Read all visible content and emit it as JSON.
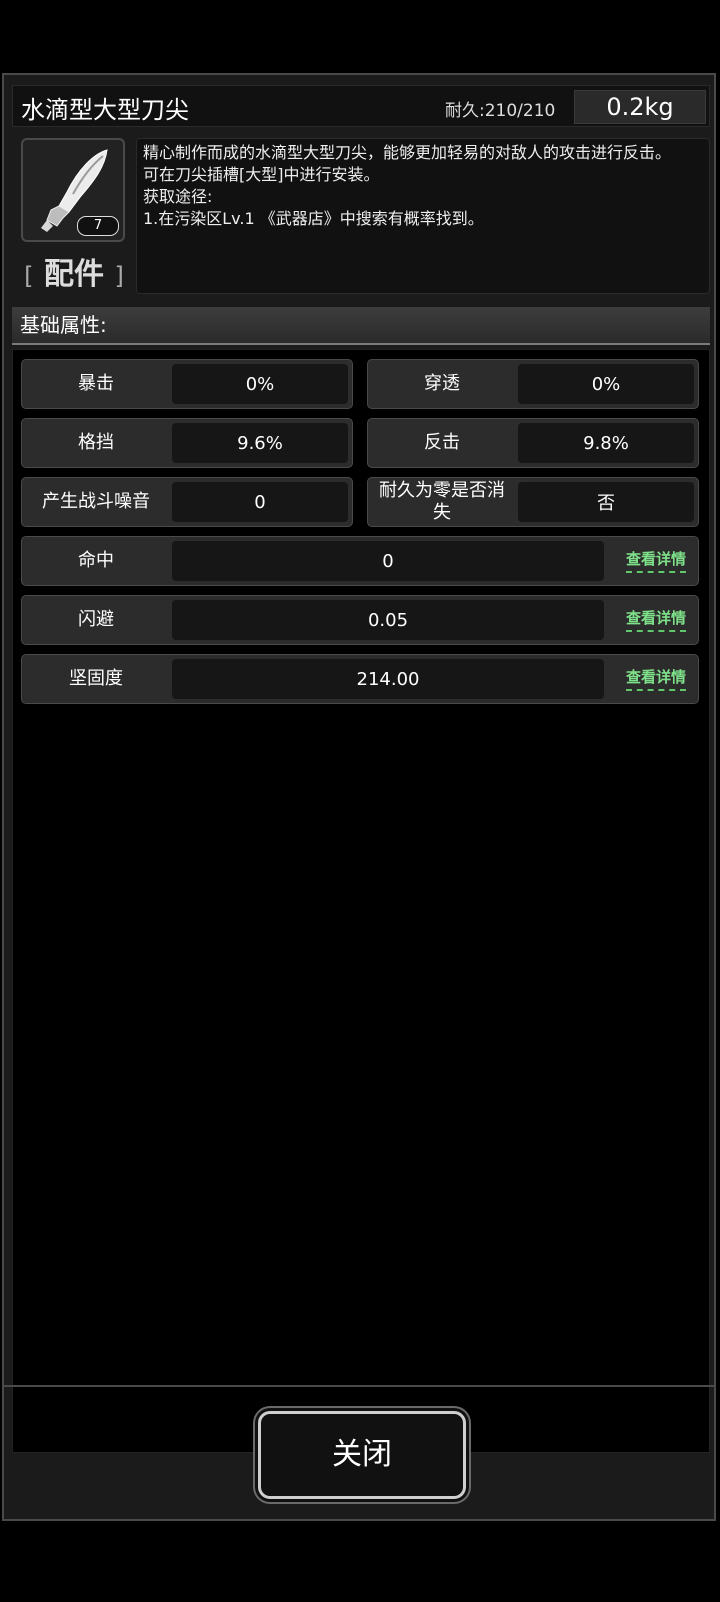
{
  "item": {
    "name": "水滴型大型刀尖",
    "durability": "耐久:210/210",
    "weight": "0.2kg",
    "count": "7",
    "category_open": "[",
    "category": "配件",
    "category_close": "]",
    "icon": "blade-tip-icon"
  },
  "description": {
    "lines": [
      "精心制作而成的水滴型大型刀尖，能够更加轻易的对敌人的攻击进行反击。",
      "可在刀尖插槽[大型]中进行安装。",
      "获取途径:",
      "1.在污染区Lv.1 《武器店》中搜索有概率找到。"
    ]
  },
  "section": {
    "title": "基础属性:"
  },
  "stats": {
    "crit": {
      "label": "暴击",
      "value": "0%"
    },
    "pierce": {
      "label": "穿透",
      "value": "0%"
    },
    "block": {
      "label": "格挡",
      "value": "9.6%"
    },
    "counter": {
      "label": "反击",
      "value": "9.8%"
    },
    "noise": {
      "label": "产生战斗噪音",
      "value": "0"
    },
    "vanish": {
      "label": "耐久为零是否消失",
      "value": "否"
    },
    "hit": {
      "label": "命中",
      "value": "0",
      "detail": "查看详情"
    },
    "dodge": {
      "label": "闪避",
      "value": "0.05",
      "detail": "查看详情"
    },
    "toughness": {
      "label": "坚固度",
      "value": "214.00",
      "detail": "查看详情"
    }
  },
  "close_button": {
    "label": "关闭"
  }
}
